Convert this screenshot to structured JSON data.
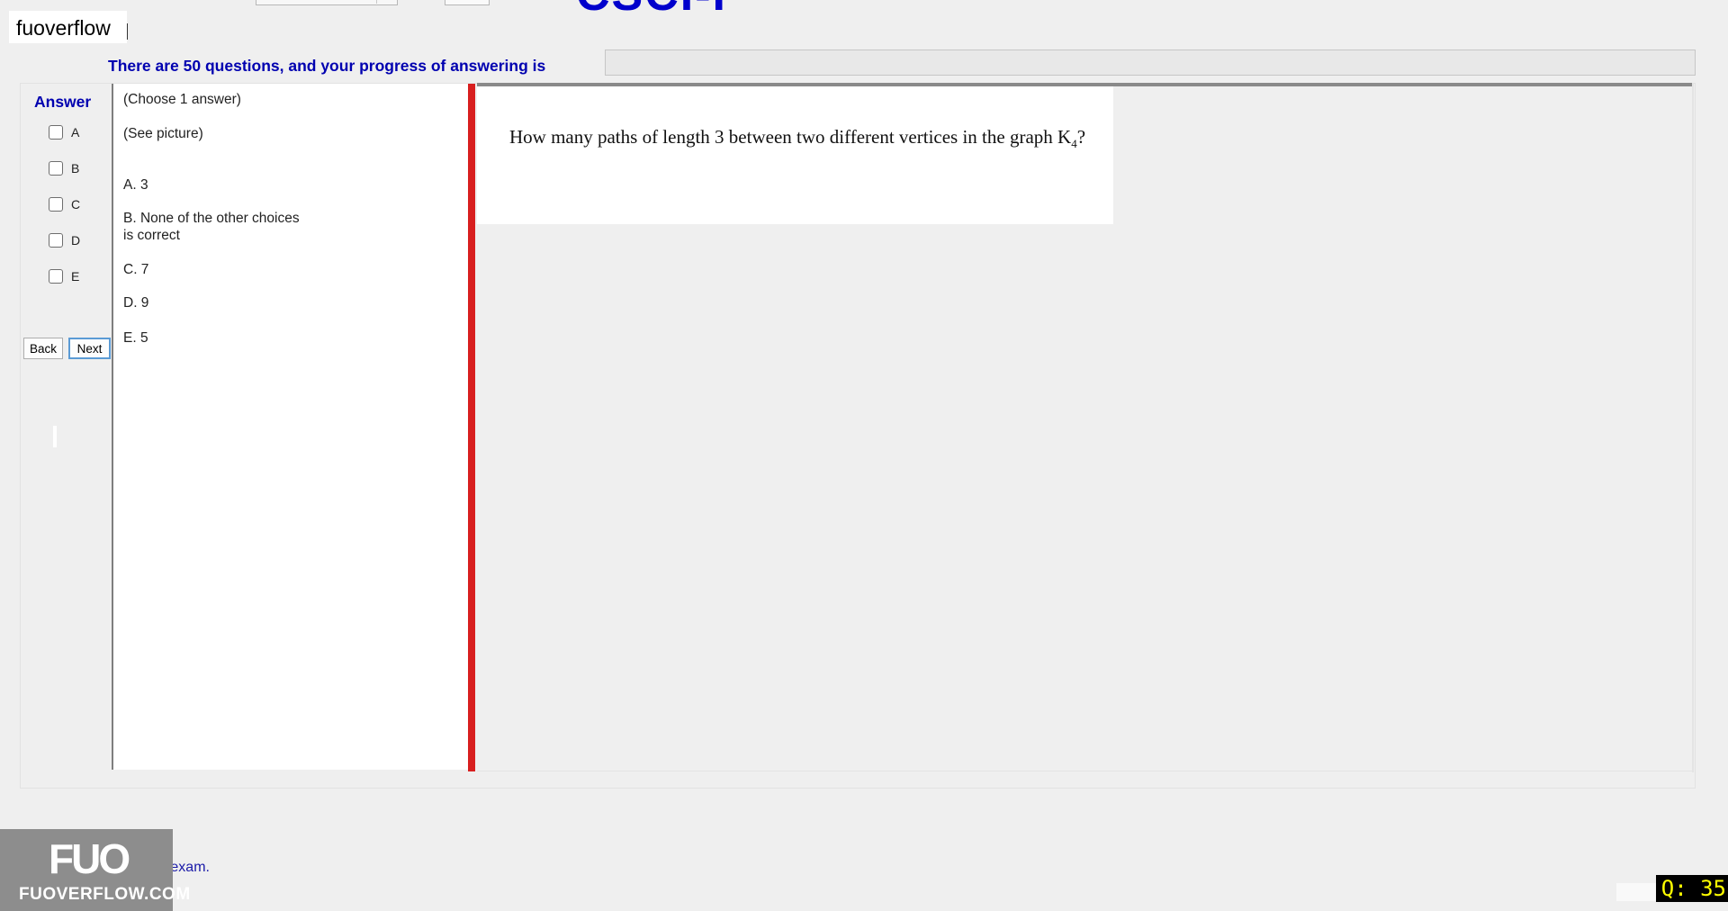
{
  "header": {
    "exam_code": "CSCI-I",
    "brand": "fuoverflow",
    "progress_text": "There are 50 questions, and your progress of answering is",
    "progress_value": 0
  },
  "answer_sidebar": {
    "title": "Answer",
    "options": [
      {
        "label": "A",
        "checked": false
      },
      {
        "label": "B",
        "checked": false
      },
      {
        "label": "C",
        "checked": false
      },
      {
        "label": "D",
        "checked": false
      },
      {
        "label": "E",
        "checked": false
      }
    ],
    "back_label": "Back",
    "next_label": "Next"
  },
  "answers_panel": {
    "instruction": "(Choose 1 answer)",
    "note": "(See picture)",
    "choices": [
      {
        "text": "A.  3"
      },
      {
        "text": "B.  None of the other choices\nis correct"
      },
      {
        "text": "C.  7"
      },
      {
        "text": "D.  9"
      },
      {
        "text": "E.  5"
      }
    ]
  },
  "question": {
    "text_before": "How many paths of length 3 between two different vertices in the graph K",
    "subscript": "4",
    "text_after": "?"
  },
  "footer": {
    "finish_label": "I want to finish the exam.",
    "logo_mark": "FUO",
    "logo_sub": "FUOVERFLOW.COM",
    "question_counter": "Q: 35"
  },
  "colors": {
    "label_blue": "#0000b0",
    "divider_red": "#d81f1f",
    "counter_yellow": "#ffff00"
  }
}
